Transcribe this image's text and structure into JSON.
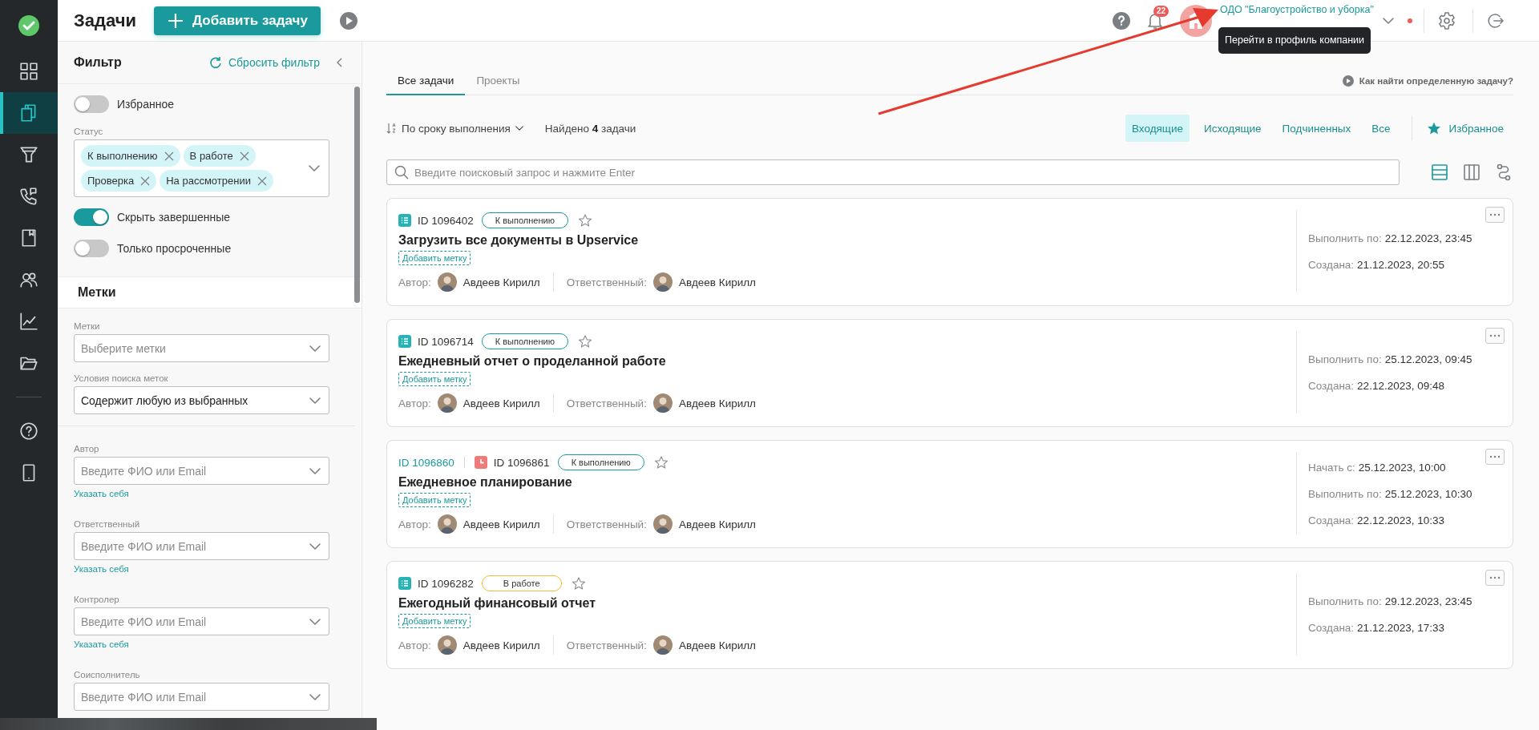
{
  "nav": {
    "items": [
      {
        "selected": false
      },
      {
        "selected": true
      },
      {
        "selected": false
      },
      {
        "selected": false
      },
      {
        "selected": false
      },
      {
        "selected": false
      },
      {
        "selected": false
      },
      {
        "selected": false
      },
      {
        "selected": false
      },
      {
        "selected": false
      }
    ]
  },
  "header": {
    "title": "Задачи",
    "add_button": "Добавить задачу",
    "notifications_badge": "22",
    "company": "ОДО \"Благоустройство и уборка\"",
    "tooltip": "Перейти в профиль компании",
    "online": true
  },
  "filter": {
    "title": "Фильтр",
    "reset": "Сбросить фильтр",
    "items": [
      {
        "kind": "toggle",
        "label": "Избранное",
        "on": false
      },
      {
        "kind": "multiselect",
        "label": "Статус",
        "chips": [
          "К выполнению",
          "В работе",
          "Проверка",
          "На рассмотрении"
        ]
      },
      {
        "kind": "toggle",
        "label": "Скрыть завершенные",
        "on": true
      },
      {
        "kind": "toggle",
        "label": "Только просроченные",
        "on": false
      },
      {
        "kind": "section",
        "label": "Метки"
      },
      {
        "kind": "select",
        "label": "Метки",
        "placeholder": "Выберите метки"
      },
      {
        "kind": "select",
        "label": "Условия поиска меток",
        "value": "Содержит любую из выбранных"
      },
      {
        "kind": "select",
        "label": "Автор",
        "placeholder": "Введите ФИО или Email",
        "link": "Указать себя"
      },
      {
        "kind": "select",
        "label": "Ответственный",
        "placeholder": "Введите ФИО или Email",
        "link": "Указать себя"
      },
      {
        "kind": "select",
        "label": "Контролер",
        "placeholder": "Введите ФИО или Email",
        "link": "Указать себя"
      },
      {
        "kind": "select",
        "label": "Соисполнитель",
        "placeholder": "Введите ФИО или Email"
      }
    ]
  },
  "tabs": [
    {
      "label": "Все задачи",
      "selected": true
    },
    {
      "label": "Проекты",
      "selected": false
    }
  ],
  "help_link": "Как найти определенную задачу?",
  "sort": "По сроку выполнения",
  "found": "Найдено **4** задачи",
  "segments": [
    {
      "label": "Входящие",
      "selected": true
    },
    {
      "label": "Исходящие",
      "selected": false
    },
    {
      "label": "Подчиненных",
      "selected": false
    },
    {
      "label": "Все",
      "selected": false
    }
  ],
  "favorites_filter": "Избранное",
  "search": {
    "placeholder": "Введите поисковый запрос и нажмите Enter"
  },
  "views": [
    {
      "selected": true
    },
    {
      "selected": false
    },
    {
      "selected": false
    }
  ],
  "tasks": [
    {
      "kind": "task",
      "id": "ID 1096402",
      "status": {
        "label": "К выполнению",
        "kind": "todo"
      },
      "favorite": false,
      "title": "Загрузить все документы в Upservice",
      "tag_button": "Добавить метку",
      "author_label": "Автор:",
      "author": "Авдеев Кирилл",
      "responsible_label": "Ответственный:",
      "responsible": "Авдеев Кирилл",
      "dates": [
        {
          "label": "Выполнить по:",
          "value": "22.12.2023, 23:45"
        },
        {
          "label": "Создана:",
          "value": "21.12.2023, 20:55"
        }
      ]
    },
    {
      "kind": "task",
      "id": "ID 1096714",
      "status": {
        "label": "К выполнению",
        "kind": "todo"
      },
      "favorite": false,
      "title": "Ежедневный отчет о проделанной работе",
      "tag_button": "Добавить метку",
      "author_label": "Автор:",
      "author": "Авдеев Кирилл",
      "responsible_label": "Ответственный:",
      "responsible": "Авдеев Кирилл",
      "dates": [
        {
          "label": "Выполнить по:",
          "value": "25.12.2023, 09:45"
        },
        {
          "label": "Создана:",
          "value": "22.12.2023, 09:48"
        }
      ]
    },
    {
      "kind": "event",
      "parent_id": "ID 1096860",
      "id": "ID 1096861",
      "status": {
        "label": "К выполнению",
        "kind": "todo"
      },
      "favorite": false,
      "title": "Ежедневное планирование",
      "tag_button": "Добавить метку",
      "author_label": "Автор:",
      "author": "Авдеев Кирилл",
      "responsible_label": "Ответственный:",
      "responsible": "Авдеев Кирилл",
      "dates": [
        {
          "label": "Начать с:",
          "value": "25.12.2023, 10:00"
        },
        {
          "label": "Выполнить по:",
          "value": "25.12.2023, 10:30"
        },
        {
          "label": "Создана:",
          "value": "22.12.2023, 10:33"
        }
      ]
    },
    {
      "kind": "task",
      "id": "ID 1096282",
      "status": {
        "label": "В работе",
        "kind": "in_progress"
      },
      "favorite": false,
      "title": "Ежегодный финансовый отчет",
      "tag_button": "Добавить метку",
      "author_label": "Автор:",
      "author": "Авдеев Кирилл",
      "responsible_label": "Ответственный:",
      "responsible": "Авдеев Кирилл",
      "dates": [
        {
          "label": "Выполнить по:",
          "value": "29.12.2023, 23:45"
        },
        {
          "label": "Создана:",
          "value": "21.12.2023, 17:33"
        }
      ]
    }
  ]
}
